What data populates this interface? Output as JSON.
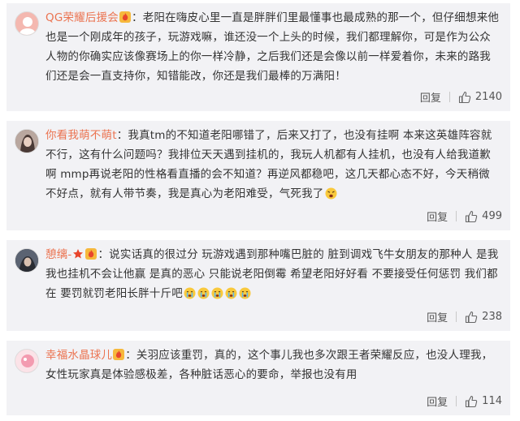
{
  "comments": [
    {
      "username": "QG荣耀后援会",
      "text": "：老阳在嗨皮心里一直是胖胖们里最懂事也最成熟的那一个，但仔细想来他也是一个刚成年的孩子，玩游戏嘛，谁还没一个上头的时候，我们都理解你，可是作为公众人物的你确实应该像赛场上的你一样冷静，之后我们还是会像以前一样爱着你，未来的路我们还是会一直支持你，知错能改，你还是我们最棒的万满阳！",
      "reply_label": "回复",
      "likes": "2140",
      "avatar_color": "#f4b8b0",
      "badge_icon": "fire-badge-icon"
    },
    {
      "username": "你看我萌不萌t",
      "text": "：我真tm的不知道老阳哪错了，后来又打了，也没有挂啊 本来这英雄阵容就不行，这有什么问题吗？我排位天天遇到挂机的，我玩人机都有人挂机，也没有人给我道歉啊 mmp再说老阳的性格看直播的会不知道？再逆风都稳吧，这几天都心态不好，今天稍微不好点，就有人带节奏，我是真心为老阳难受，气死我了",
      "reply_label": "回复",
      "likes": "499",
      "avatar_color": "#7a6a68",
      "emoji_icon": "angry-face-emoji-icon"
    },
    {
      "username": "憩缡-",
      "text": "：说实话真的很过分 玩游戏遇到那种嘴巴脏的 脏到调戏飞牛女朋友的那种人 是我 我也挂机不会让他赢 是真的恶心 只能说老阳倒霉 希望老阳好好看 不要接受任何惩罚 我们都在 要罚就罚老阳长胖十斤吧",
      "reply_label": "回复",
      "likes": "238",
      "avatar_color": "#3c3f4a",
      "star_icon": "red-star-icon",
      "emoji_icon": "crying-face-emoji-icon",
      "emoji_count": 5
    },
    {
      "username": "幸福水晶球儿",
      "text": "：关羽应该重罚，真的，这个事儿我也多次跟王者荣耀反应，也没人理我，女性玩家真是体验感极差，各种脏话恶心的要命，举报也没有用",
      "reply_label": "回复",
      "likes": "114",
      "avatar_color": "#f7c4cf"
    }
  ]
}
